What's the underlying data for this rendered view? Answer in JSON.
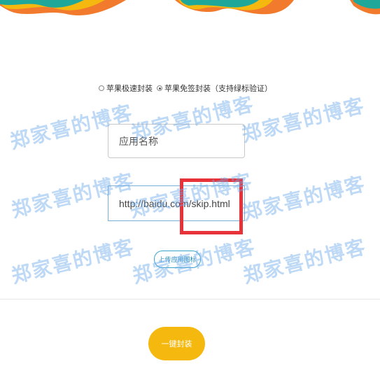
{
  "colors": {
    "deco_teal": "#1fa79a",
    "deco_yellow": "#f5b80f",
    "deco_orange": "#f27a2c",
    "submit_bg": "#f5b80f",
    "upload_border": "#3aa3c9",
    "highlight_border": "#e8323a",
    "watermark": "#6eaaeb"
  },
  "packaging_options": {
    "items": [
      {
        "label": "苹果极速封装",
        "selected": false
      },
      {
        "label": "苹果免签封装（支持绿标验证）",
        "selected": true
      }
    ]
  },
  "form": {
    "app_name": {
      "placeholder": "应用名称",
      "value": ""
    },
    "url": {
      "value": "http://baidu.com/skip.html"
    },
    "upload_icon_label": "上传应用图标",
    "submit_label": "一键封装"
  },
  "watermark": {
    "text": "郑家喜的博客"
  }
}
